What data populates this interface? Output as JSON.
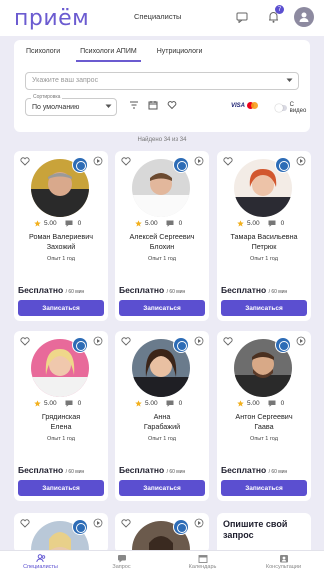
{
  "header": {
    "logo": "приём",
    "nav_title": "Специалисты",
    "notifications_count": "7"
  },
  "tabs": [
    {
      "label": "Психологи",
      "active": false
    },
    {
      "label": "Психологи АПИМ",
      "active": true
    },
    {
      "label": "Нутрициологи",
      "active": false
    }
  ],
  "search": {
    "placeholder": "Укажите ваш запрос"
  },
  "sort": {
    "label": "Сортировка",
    "value": "По умолчанию"
  },
  "filters": {
    "visa": "VISA",
    "video_label": "С видео"
  },
  "found_text": "Найдено 34 из 34",
  "cards": [
    {
      "name_line1": "Роман Валериевич",
      "name_line2": "Захожий",
      "rating": "5.00",
      "reviews": "0",
      "experience": "Опыт 1 год",
      "price": "Бесплатно",
      "duration": "/ 60 мин",
      "button": "Записаться"
    },
    {
      "name_line1": "Алексей Сергеевич",
      "name_line2": "Блохин",
      "rating": "5.00",
      "reviews": "0",
      "experience": "Опыт 1 год",
      "price": "Бесплатно",
      "duration": "/ 60 мин",
      "button": "Записаться"
    },
    {
      "name_line1": "Тамара Васильевна",
      "name_line2": "Петрюк",
      "rating": "5.00",
      "reviews": "0",
      "experience": "Опыт 1 год",
      "price": "Бесплатно",
      "duration": "/ 60 мин",
      "button": "Записаться"
    },
    {
      "name_line1": "Грядинская",
      "name_line2": "Елена",
      "rating": "5.00",
      "reviews": "0",
      "experience": "Опыт 1 год",
      "price": "Бесплатно",
      "duration": "/ 60 мин",
      "button": "Записаться"
    },
    {
      "name_line1": "Анна",
      "name_line2": "Гарабажий",
      "rating": "5.00",
      "reviews": "0",
      "experience": "Опыт 1 год",
      "price": "Бесплатно",
      "duration": "/ 60 мин",
      "button": "Записаться"
    },
    {
      "name_line1": "Антон Сергеевич",
      "name_line2": "Гаава",
      "rating": "5.00",
      "reviews": "0",
      "experience": "Опыт 1 год",
      "price": "Бесплатно",
      "duration": "/ 60 мин",
      "button": "Записаться"
    }
  ],
  "ask_card": {
    "text": "Опишите свой запрос"
  },
  "bottom_nav": [
    {
      "label": "Специалисты",
      "active": true
    },
    {
      "label": "Запрос",
      "active": false
    },
    {
      "label": "Календарь",
      "active": false
    },
    {
      "label": "Консультации",
      "active": false
    }
  ],
  "colors": {
    "accent": "#5b4fd0",
    "background": "#ecebf5",
    "star": "#f2b01e"
  }
}
